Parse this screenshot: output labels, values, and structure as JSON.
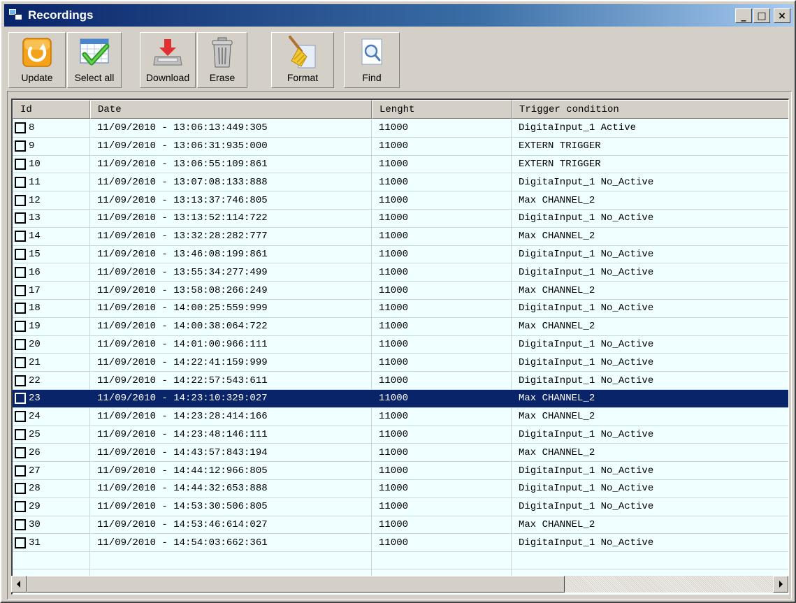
{
  "window": {
    "title": "Recordings",
    "buttons": {
      "minimize": "_",
      "maximize": "□",
      "close": "×"
    }
  },
  "toolbar": {
    "update": "Update",
    "select_all": "Select all",
    "download": "Download",
    "erase": "Erase",
    "format": "Format",
    "find": "Find"
  },
  "table": {
    "columns": [
      "Id",
      "Date",
      "Lenght",
      "Trigger condition"
    ],
    "selected_id": "23",
    "rows": [
      {
        "id": "8",
        "date": "11/09/2010 - 13:06:13:449:305",
        "length": "11000",
        "trigger": "DigitaInput_1 Active"
      },
      {
        "id": "9",
        "date": "11/09/2010 - 13:06:31:935:000",
        "length": "11000",
        "trigger": "EXTERN TRIGGER"
      },
      {
        "id": "10",
        "date": "11/09/2010 - 13:06:55:109:861",
        "length": "11000",
        "trigger": "EXTERN TRIGGER"
      },
      {
        "id": "11",
        "date": "11/09/2010 - 13:07:08:133:888",
        "length": "11000",
        "trigger": "DigitaInput_1 No_Active"
      },
      {
        "id": "12",
        "date": "11/09/2010 - 13:13:37:746:805",
        "length": "11000",
        "trigger": "Max CHANNEL_2"
      },
      {
        "id": "13",
        "date": "11/09/2010 - 13:13:52:114:722",
        "length": "11000",
        "trigger": "DigitaInput_1 No_Active"
      },
      {
        "id": "14",
        "date": "11/09/2010 - 13:32:28:282:777",
        "length": "11000",
        "trigger": "Max CHANNEL_2"
      },
      {
        "id": "15",
        "date": "11/09/2010 - 13:46:08:199:861",
        "length": "11000",
        "trigger": "DigitaInput_1 No_Active"
      },
      {
        "id": "16",
        "date": "11/09/2010 - 13:55:34:277:499",
        "length": "11000",
        "trigger": "DigitaInput_1 No_Active"
      },
      {
        "id": "17",
        "date": "11/09/2010 - 13:58:08:266:249",
        "length": "11000",
        "trigger": "Max CHANNEL_2"
      },
      {
        "id": "18",
        "date": "11/09/2010 - 14:00:25:559:999",
        "length": "11000",
        "trigger": "DigitaInput_1 No_Active"
      },
      {
        "id": "19",
        "date": "11/09/2010 - 14:00:38:064:722",
        "length": "11000",
        "trigger": "Max CHANNEL_2"
      },
      {
        "id": "20",
        "date": "11/09/2010 - 14:01:00:966:111",
        "length": "11000",
        "trigger": "DigitaInput_1 No_Active"
      },
      {
        "id": "21",
        "date": "11/09/2010 - 14:22:41:159:999",
        "length": "11000",
        "trigger": "DigitaInput_1 No_Active"
      },
      {
        "id": "22",
        "date": "11/09/2010 - 14:22:57:543:611",
        "length": "11000",
        "trigger": "DigitaInput_1 No_Active"
      },
      {
        "id": "23",
        "date": "11/09/2010 - 14:23:10:329:027",
        "length": "11000",
        "trigger": "Max CHANNEL_2"
      },
      {
        "id": "24",
        "date": "11/09/2010 - 14:23:28:414:166",
        "length": "11000",
        "trigger": "Max CHANNEL_2"
      },
      {
        "id": "25",
        "date": "11/09/2010 - 14:23:48:146:111",
        "length": "11000",
        "trigger": "DigitaInput_1 No_Active"
      },
      {
        "id": "26",
        "date": "11/09/2010 - 14:43:57:843:194",
        "length": "11000",
        "trigger": "Max CHANNEL_2"
      },
      {
        "id": "27",
        "date": "11/09/2010 - 14:44:12:966:805",
        "length": "11000",
        "trigger": "DigitaInput_1 No_Active"
      },
      {
        "id": "28",
        "date": "11/09/2010 - 14:44:32:653:888",
        "length": "11000",
        "trigger": "DigitaInput_1 No_Active"
      },
      {
        "id": "29",
        "date": "11/09/2010 - 14:53:30:506:805",
        "length": "11000",
        "trigger": "DigitaInput_1 No_Active"
      },
      {
        "id": "30",
        "date": "11/09/2010 - 14:53:46:614:027",
        "length": "11000",
        "trigger": "Max CHANNEL_2"
      },
      {
        "id": "31",
        "date": "11/09/2010 - 14:54:03:662:361",
        "length": "11000",
        "trigger": "DigitaInput_1 No_Active"
      }
    ]
  },
  "scrollbar": {
    "left_arrow": "◀",
    "right_arrow": "▶"
  },
  "colors": {
    "title_start": "#0a246a",
    "title_end": "#a6caf0",
    "selection": "#0a246a",
    "list_bg": "#f0ffff",
    "face": "#d4d0c8"
  },
  "icons": {
    "title": "recordings-app-icon",
    "update": "refresh-icon",
    "select_all": "calendar-checkmark-icon",
    "download": "download-tray-icon",
    "erase": "trash-can-icon",
    "format": "broom-icon",
    "find": "magnifier-icon"
  }
}
